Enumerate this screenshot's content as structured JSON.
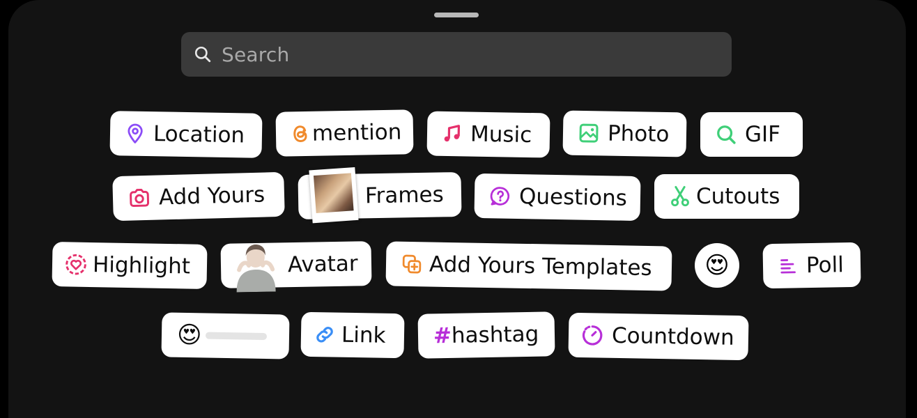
{
  "search": {
    "placeholder": "Search"
  },
  "stickers": {
    "location": {
      "label": "Location",
      "icon": "location-pin-icon",
      "color": "#8b4cf7"
    },
    "mention": {
      "label": "mention",
      "icon": "threads-at-icon",
      "color": "#f08a2c"
    },
    "music": {
      "label": "Music",
      "icon": "music-note-icon",
      "color": "#e5306b"
    },
    "photo": {
      "label": "Photo",
      "icon": "photo-icon",
      "color": "#3fcf78"
    },
    "gif": {
      "label": "GIF",
      "icon": "search-icon",
      "color": "#3fcf78"
    },
    "add_yours": {
      "label": "Add Yours",
      "icon": "camera-icon",
      "color": "#e5306b"
    },
    "frames": {
      "label": "Frames",
      "icon": "polaroid-photo"
    },
    "questions": {
      "label": "Questions",
      "icon": "question-bubble-icon",
      "color": "#b72fd8"
    },
    "cutouts": {
      "label": "Cutouts",
      "icon": "scissors-icon",
      "color": "#3fcf78"
    },
    "highlight": {
      "label": "Highlight",
      "icon": "heart-circle-icon",
      "color": "#e5306b"
    },
    "avatar": {
      "label": "Avatar",
      "icon": "avatar-figure"
    },
    "add_yours_templates": {
      "label": "Add Yours Templates",
      "icon": "plus-squares-icon",
      "color": "#f08a2c"
    },
    "emoji_reaction": {
      "emoji": "😍"
    },
    "poll": {
      "label": "Poll",
      "icon": "poll-lines-icon",
      "color": "#b72fd8"
    },
    "emoji_slider": {
      "emoji": "😍"
    },
    "link": {
      "label": "Link",
      "icon": "link-icon",
      "color": "#3a8ef6"
    },
    "hashtag": {
      "label": "#hashtag",
      "color": "#b72fd8"
    },
    "countdown": {
      "label": "Countdown",
      "icon": "countdown-timer-icon",
      "color": "#b72fd8"
    }
  }
}
